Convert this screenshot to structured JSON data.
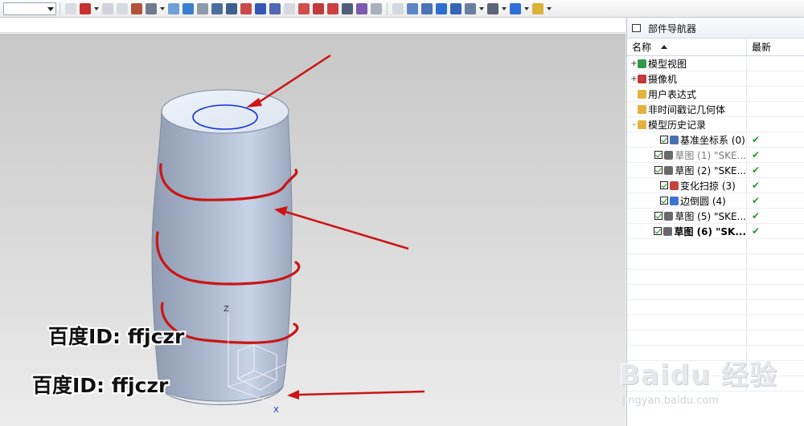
{
  "panel": {
    "title": "部件导航器",
    "col_name": "名称",
    "col_latest": "最新"
  },
  "tree": [
    {
      "expander": "+",
      "icon": "model-views-icon",
      "label": "模型视图",
      "latest": "",
      "style": "normal"
    },
    {
      "expander": "+",
      "icon": "camera-icon",
      "label": "摄像机",
      "latest": "",
      "style": "normal"
    },
    {
      "expander": "",
      "icon": "folder-icon",
      "label": "用户表达式",
      "latest": "",
      "style": "normal"
    },
    {
      "expander": "",
      "icon": "folder-icon",
      "label": "非时间戳记几何体",
      "latest": "",
      "style": "normal"
    },
    {
      "expander": "-",
      "icon": "folder-open-icon",
      "label": "模型历史记录",
      "latest": "",
      "style": "normal"
    },
    {
      "expander": "",
      "icon": "datum-csys-icon",
      "label": "基准坐标系 (0)",
      "latest": "✔",
      "style": "normal",
      "checked": true
    },
    {
      "expander": "",
      "icon": "sketch-icon",
      "label": "草图 (1) \"SKE...",
      "latest": "✔",
      "style": "grey",
      "checked": true
    },
    {
      "expander": "",
      "icon": "sketch-icon",
      "label": "草图 (2) \"SKE...",
      "latest": "✔",
      "style": "normal",
      "checked": true
    },
    {
      "expander": "",
      "icon": "variational-sweep-icon",
      "label": "变化扫掠 (3)",
      "latest": "✔",
      "style": "normal",
      "checked": true
    },
    {
      "expander": "",
      "icon": "edge-blend-icon",
      "label": "边倒圆 (4)",
      "latest": "✔",
      "style": "normal",
      "checked": true
    },
    {
      "expander": "",
      "icon": "sketch-icon",
      "label": "草图 (5) \"SKE...",
      "latest": "✔",
      "style": "normal",
      "checked": true
    },
    {
      "expander": "",
      "icon": "sketch-icon",
      "label": "草图 (6) \"SK...",
      "latest": "✔",
      "style": "bold",
      "checked": true
    }
  ],
  "viewport": {
    "axis_z": "Z",
    "axis_x": "X",
    "watermark_1": "百度ID: ffjczr",
    "watermark_2": "百度ID: ffjczr"
  },
  "baidu": {
    "logo": "Baidu 经验",
    "url": "jingyan.baidu.com"
  },
  "colors": {
    "body_light": "#c8d3e4",
    "body_dark": "#8e9ab0",
    "top_face": "#e6eef8",
    "annotation_red": "#cc1414",
    "sketch_blue": "#1030d8"
  }
}
